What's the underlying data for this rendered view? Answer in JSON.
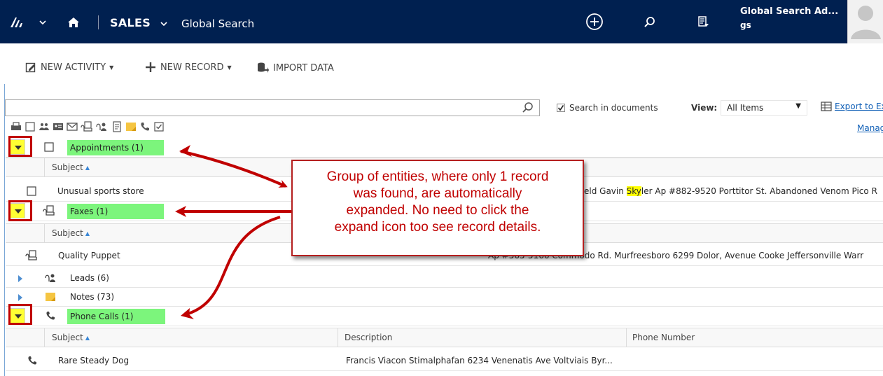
{
  "nav": {
    "area": "SALES",
    "page": "Global Search",
    "user_name": "Global Search Ad...",
    "user_short": "gs"
  },
  "toolbar": {
    "new_activity": "NEW ACTIVITY",
    "new_record": "NEW RECORD",
    "import_data": "IMPORT DATA"
  },
  "search": {
    "query": "",
    "search_in_documents": "Search in documents",
    "search_in_documents_checked": true,
    "view_label": "View:",
    "view_value": "All Items",
    "export_link": "Export to Excel",
    "manage_link": "Manage"
  },
  "groups": {
    "appointments": {
      "label": "Appointments (1)",
      "subject_header": "Subject",
      "record_subject": "Unusual sports store",
      "record_desc_before": "eld Gavin ",
      "record_desc_highlight": "Sky",
      "record_desc_after": "ler Ap #882-9520 Porttitor St. Abandoned Venom Pico R"
    },
    "faxes": {
      "label": "Faxes (1)",
      "subject_header": "Subject",
      "record_subject": "Quality Puppet",
      "record_desc": "Ap #565-5166 Commodo Rd. Murfreesboro 6299 Dolor, Avenue Cooke Jeffersonville Warr"
    },
    "leads": {
      "label": "Leads (6)"
    },
    "notes": {
      "label": "Notes (73)"
    },
    "phone_calls": {
      "label": "Phone Calls (1)",
      "subject_header": "Subject",
      "description_header": "Description",
      "phone_header": "Phone Number",
      "record_subject": "Rare Steady Dog",
      "record_desc": "Francis Viacon Stimalphafan 6234 Venenatis Ave Voltviais Byr..."
    }
  },
  "callout": {
    "line1": "Group of entities, where only 1 record",
    "line2": "was found, are automatically",
    "line3": "expanded. No need to click the",
    "line4": "expand icon too see record details."
  },
  "colors": {
    "nav_bg": "#002050",
    "highlight_green": "#7cf57c",
    "annotation_red": "#c00000",
    "toggle_yellow": "#ffff33",
    "link_blue": "#1160b7"
  }
}
